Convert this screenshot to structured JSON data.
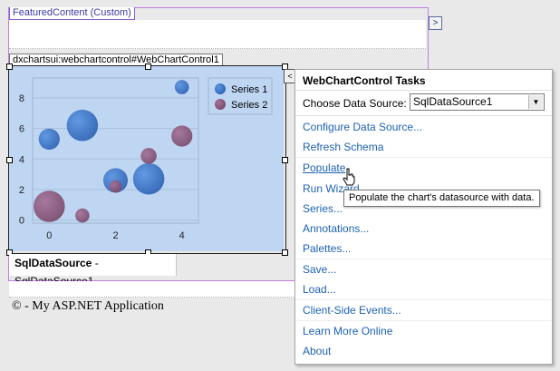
{
  "featured": {
    "tag": "FeaturedContent (Custom)",
    "smart_glyph": ">"
  },
  "control": {
    "tag": "dxchartsui:webchartcontrol#WebChartControl1"
  },
  "datasource_panel": {
    "name": "SqlDataSource",
    "rest": " - SqlDataSource1"
  },
  "footer": "© - My ASP.NET Application",
  "tasks": {
    "smart_glyph": "<",
    "title": "WebChartControl Tasks",
    "datasource_label": "Choose Data Source:",
    "datasource_value": "SqlDataSource1",
    "links": [
      "Configure Data Source...",
      "Refresh Schema",
      "Populate",
      "Run Wizard...",
      "Series...",
      "Annotations...",
      "Palettes...",
      "Save...",
      "Load...",
      "Client-Side Events...",
      "Learn More Online",
      "About"
    ],
    "tooltip": "Populate the chart's datasource with data."
  },
  "colors": {
    "series1": "#3a72c6",
    "series2": "#8b5a7e",
    "link": "#1c62b4"
  },
  "chart_data": {
    "type": "scatter",
    "variant": "bubble",
    "x_ticks": [
      0,
      2,
      4
    ],
    "y_ticks": [
      0,
      2,
      4,
      6,
      8
    ],
    "xlim": [
      -0.5,
      4.5
    ],
    "ylim": [
      -0.2,
      9.3
    ],
    "grid": true,
    "legend_position": "top-right",
    "series": [
      {
        "name": "Series 1",
        "color": "#3a72c6",
        "points": [
          {
            "x": 0,
            "y": 5.3,
            "size": 4
          },
          {
            "x": 1,
            "y": 6.2,
            "size": 7
          },
          {
            "x": 2,
            "y": 2.6,
            "size": 5
          },
          {
            "x": 3,
            "y": 2.7,
            "size": 7
          },
          {
            "x": 4,
            "y": 8.7,
            "size": 2
          }
        ]
      },
      {
        "name": "Series 2",
        "color": "#8b5a7e",
        "points": [
          {
            "x": 0,
            "y": 0.9,
            "size": 7
          },
          {
            "x": 1,
            "y": 0.3,
            "size": 2
          },
          {
            "x": 2,
            "y": 2.2,
            "size": 1.5
          },
          {
            "x": 3,
            "y": 4.2,
            "size": 2.5
          },
          {
            "x": 4,
            "y": 5.5,
            "size": 4
          }
        ]
      }
    ]
  }
}
